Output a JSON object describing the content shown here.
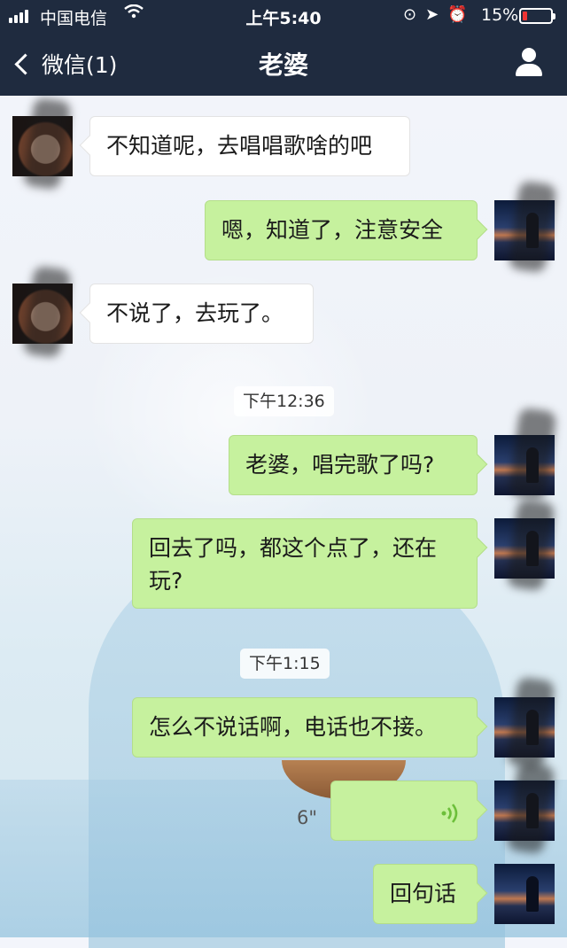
{
  "status_bar": {
    "carrier": "中国电信",
    "time": "上午5:40",
    "battery": "15%",
    "battery_level": 0.15
  },
  "nav": {
    "back_label": "微信(1)",
    "title": "老婆"
  },
  "messages": [
    {
      "side": "left",
      "text": "不知道呢，去唱唱歌啥的吧"
    },
    {
      "side": "right",
      "text": "嗯，知道了，注意安全"
    },
    {
      "side": "left",
      "text": "不说了，去玩了。"
    },
    {
      "type": "time",
      "text": "下午12:36"
    },
    {
      "side": "right",
      "text": "老婆，唱完歌了吗?"
    },
    {
      "side": "right",
      "text": "回去了吗，都这个点了，还在玩?"
    },
    {
      "type": "time",
      "text": "下午1:15"
    },
    {
      "side": "right",
      "text": "怎么不说话啊，电话也不接。"
    },
    {
      "side": "right",
      "type": "voice",
      "duration": "6\""
    },
    {
      "side": "right",
      "text": "回句话"
    }
  ]
}
